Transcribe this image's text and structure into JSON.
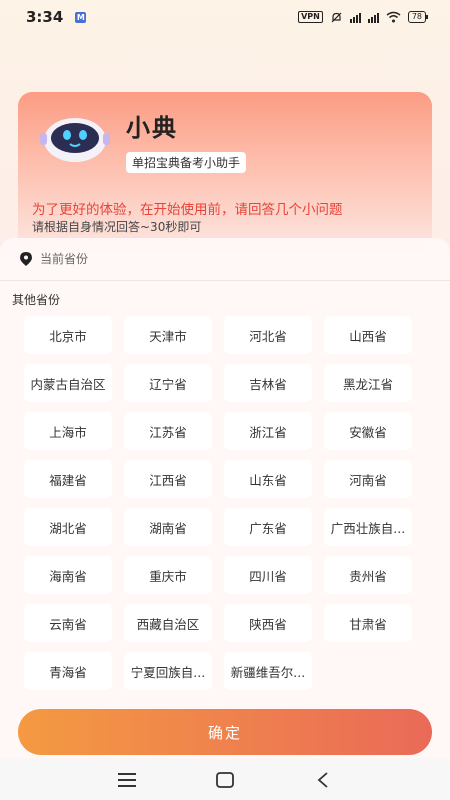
{
  "status": {
    "time": "3:34",
    "notification_icon": "M",
    "vpn": "VPN",
    "battery": "78"
  },
  "header": {
    "name": "小典",
    "tagline": "单招宝典备考小助手",
    "intro_main": "为了更好的体验，在开始使用前，请回答几个小问题",
    "intro_sub": "请根据自身情况回答~30秒即可"
  },
  "location": {
    "current_label": "当前省份",
    "other_label": "其他省份"
  },
  "provinces": [
    "北京市",
    "天津市",
    "河北省",
    "山西省",
    "内蒙古自治区",
    "辽宁省",
    "吉林省",
    "黑龙江省",
    "上海市",
    "江苏省",
    "浙江省",
    "安徽省",
    "福建省",
    "江西省",
    "山东省",
    "河南省",
    "湖北省",
    "湖南省",
    "广东省",
    "广西壮族自...",
    "海南省",
    "重庆市",
    "四川省",
    "贵州省",
    "云南省",
    "西藏自治区",
    "陕西省",
    "甘肃省",
    "青海省",
    "宁夏回族自...",
    "新疆维吾尔..."
  ],
  "actions": {
    "confirm_label": "确定"
  },
  "colors": {
    "accent_red": "#e8443a",
    "button_gradient_start": "#f49a42",
    "button_gradient_end": "#ea6a58"
  }
}
